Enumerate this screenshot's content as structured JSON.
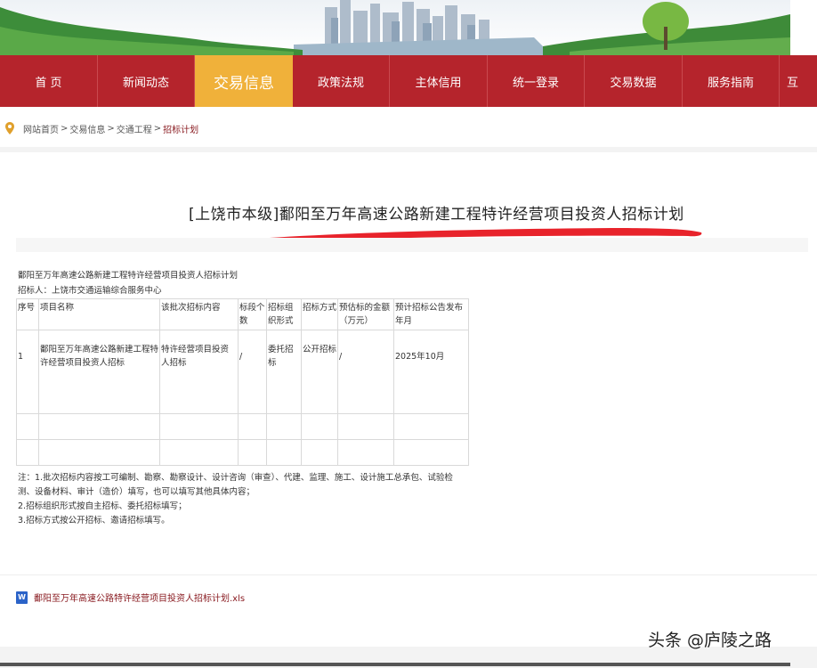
{
  "nav": {
    "items": [
      "首 页",
      "新闻动态",
      "交易信息",
      "政策法规",
      "主体信用",
      "统一登录",
      "交易数据",
      "服务指南",
      "互"
    ],
    "active_index": 2
  },
  "breadcrumb": {
    "items": [
      "网站首页",
      "交易信息",
      "交通工程"
    ],
    "separator": ">",
    "current": "招标计划"
  },
  "article": {
    "title": "[上饶市本级]鄱阳至万年高速公路新建工程特许经营项目投资人招标计划"
  },
  "sheet": {
    "heading": "鄱阳至万年高速公路新建工程特许经营项目投资人招标计划",
    "tenderer": "招标人：上饶市交通运输综合服务中心",
    "columns": [
      "序号",
      "项目名称",
      "该批次招标内容",
      "标段个数",
      "招标组织形式",
      "招标方式",
      "预估标的金额（万元）",
      "预计招标公告发布年月"
    ],
    "rows": [
      [
        "1",
        "鄱阳至万年高速公路新建工程特许经营项目投资人招标",
        "特许经营项目投资人招标",
        "/",
        "委托招标",
        "公开招标",
        "/",
        "2025年10月"
      ],
      [
        "",
        "",
        "",
        "",
        "",
        "",
        "",
        ""
      ],
      [
        "",
        "",
        "",
        "",
        "",
        "",
        "",
        ""
      ]
    ],
    "notes": [
      "注：1.批次招标内容按工可编制、勘察、勘察设计、设计咨询（审查）、代建、监理、施工、设计施工总承包、试验检测、设备材料、审计（造价）填写，也可以填写其他具体内容；",
      "2.招标组织形式按自主招标、委托招标填写；",
      "3.招标方式按公开招标、邀请招标填写。"
    ]
  },
  "attachment": {
    "filename": "鄱阳至万年高速公路特许经营项目投资人招标计划.xls",
    "icon_label": "W"
  },
  "watermark": "头条 @庐陵之路",
  "colors": {
    "nav_bg": "#b5242c",
    "nav_active": "#f0b13a",
    "link_red": "#8a1c22",
    "annotation_red": "#e8232b"
  }
}
